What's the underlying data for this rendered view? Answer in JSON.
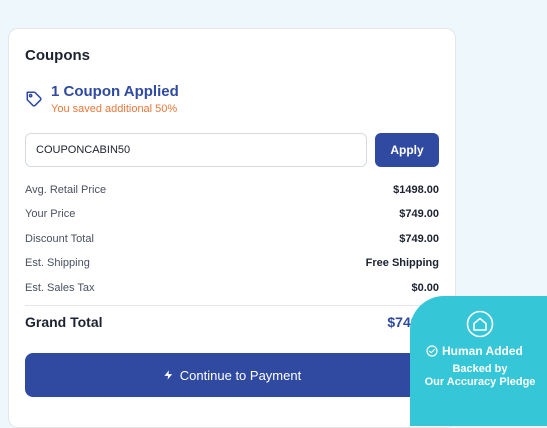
{
  "coupons": {
    "title": "Coupons",
    "applied_text": "1 Coupon Applied",
    "saved_text": "You saved additional 50%",
    "input_value": "COUPONCABIN50",
    "apply_label": "Apply",
    "icon": "tag-icon"
  },
  "summary": {
    "rows": [
      {
        "label": "Avg. Retail Price",
        "value": "$1498.00"
      },
      {
        "label": "Your Price",
        "value": "$749.00"
      },
      {
        "label": "Discount Total",
        "value": "$749.00"
      },
      {
        "label": "Est. Shipping",
        "value": "Free Shipping"
      },
      {
        "label": "Est. Sales Tax",
        "value": "$0.00"
      }
    ],
    "grand_total_label": "Grand Total",
    "grand_total_value": "$749.00"
  },
  "payment": {
    "button_label": "Continue to Payment",
    "icon": "bolt-icon"
  },
  "badge": {
    "line1": "Human Added",
    "line2": "Backed by",
    "line3": "Our Accuracy Pledge",
    "icon": "home-icon"
  },
  "colors": {
    "accent": "#2f4aa0",
    "savings": "#e8773a",
    "badge": "#35c6d8"
  }
}
